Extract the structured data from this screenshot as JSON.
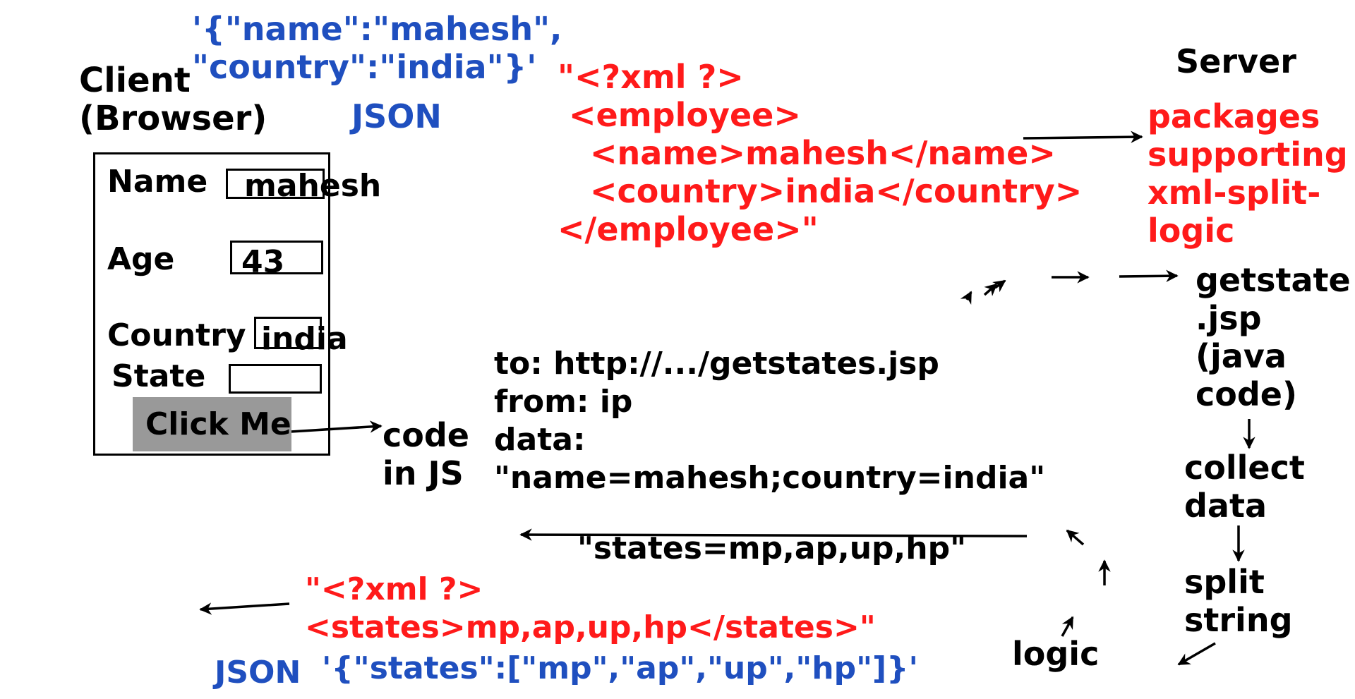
{
  "client": {
    "title_line1": "Client",
    "title_line2": "(Browser)",
    "form": {
      "name_label": "Name",
      "name_value": "mahesh",
      "age_label": "Age",
      "age_value": "43",
      "country_label": "Country",
      "country_value": "india",
      "state_label": "State",
      "state_value": "",
      "button_label": "Click Me"
    }
  },
  "json_request": {
    "line1": "'{\"name\":\"mahesh\",",
    "line2": "\"country\":\"india\"}'",
    "label": "JSON"
  },
  "xml_request": {
    "line1": "\"<?xml ?>",
    "line2": "<employee>",
    "line3": "<name>mahesh</name>",
    "line4": "<country>india</country>",
    "line5": "</employee>\""
  },
  "server": {
    "title": "Server",
    "packages_line1": "packages",
    "packages_line2": "supporting",
    "packages_line3": "xml-split-",
    "packages_line4": "logic",
    "jsp_line1": "getstate",
    "jsp_line2": ".jsp",
    "jsp_line3": "(java",
    "jsp_line4": "code)",
    "step1_line1": "collect",
    "step1_line2": "data",
    "step2_line1": "split",
    "step2_line2": "string",
    "step3": "logic"
  },
  "js_code": {
    "line1": "code",
    "line2": "in JS"
  },
  "request_details": {
    "to": "to: http://.../getstates.jsp",
    "from": "from: ip",
    "data_label": "data:",
    "data_value": "\"name=mahesh;country=india\""
  },
  "response": {
    "plain": "\"states=mp,ap,up,hp\"",
    "xml_line1": "\"<?xml ?>",
    "xml_line2": "<states>mp,ap,up,hp</states>\"",
    "json_label": "JSON",
    "json_value": "'{\"states\":[\"mp\",\"ap\",\"up\",\"hp\"]}'"
  },
  "colors": {
    "text": "#000000",
    "xml": "#ff1a1a",
    "json": "#1f4fbf",
    "button": "#999999"
  }
}
